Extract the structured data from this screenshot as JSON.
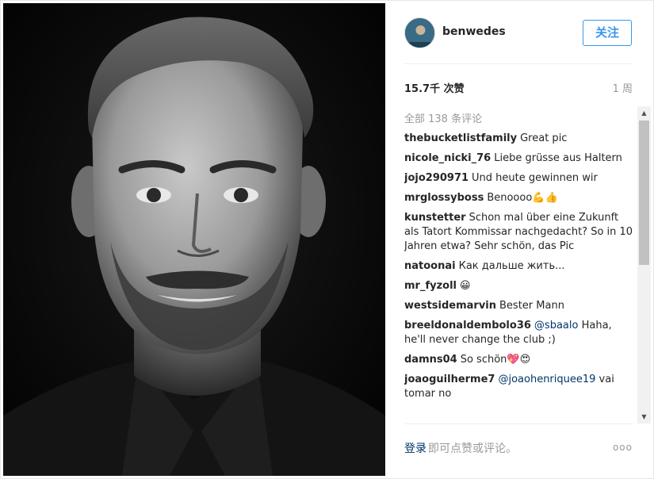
{
  "post": {
    "username": "benwedes",
    "follow_label": "关注",
    "likes": "15.7千 次赞",
    "time_ago": "1 周",
    "view_all_comments": "全部 138 条评论",
    "comments": [
      {
        "user": "thebucketlistfamily",
        "text": "Great pic"
      },
      {
        "user": "nicole_nicki_76",
        "text": "Liebe grüsse aus Haltern"
      },
      {
        "user": "jojo290971",
        "text": "Und heute gewinnen wir"
      },
      {
        "user": "mrglossyboss",
        "text": "Benoooo💪👍"
      },
      {
        "user": "kunstetter",
        "text": "Schon mal über eine Zukunft als Tatort Kommissar nachgedacht? So in 10 Jahren etwa? Sehr schön, das Pic"
      },
      {
        "user": "natoonai",
        "text": "Как дальше жить..."
      },
      {
        "user": "mr_fyzoll",
        "text": "😀"
      },
      {
        "user": "westsidemarvin",
        "text": "Bester Mann"
      },
      {
        "user": "breeldonaldembolo36",
        "mention": "@sbaalo",
        "text": " Haha, he'll never change the club ;)"
      },
      {
        "user": "damns04",
        "text": "So schön💖😍"
      },
      {
        "user": "joaoguilherme7",
        "mention": "@joaohenriquee19",
        "text": " vai tomar no"
      }
    ]
  },
  "footer": {
    "login_label": "登录",
    "login_hint": "即可点赞或评论。",
    "more_icon": "ooo"
  },
  "colors": {
    "accent": "#3897f0",
    "link": "#003569",
    "muted": "#999999"
  }
}
